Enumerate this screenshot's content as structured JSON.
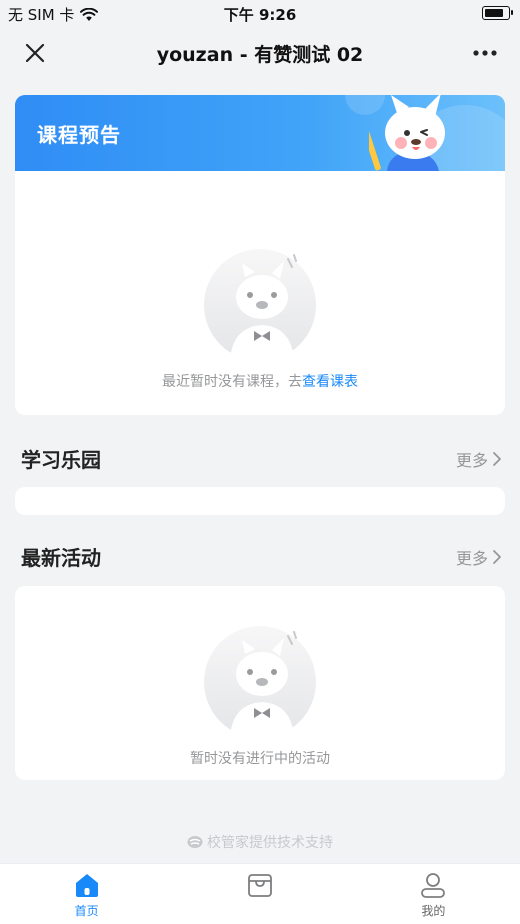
{
  "status_bar": {
    "carrier": "无 SIM 卡",
    "time": "下午 9:26",
    "battery_level": 0.85
  },
  "nav": {
    "title": "youzan - 有赞测试 02"
  },
  "course": {
    "title": "课程预告",
    "empty_text": "最近暂时没有课程，去",
    "empty_link": "查看课表"
  },
  "learning": {
    "title": "学习乐园",
    "more": "更多"
  },
  "activities": {
    "title": "最新活动",
    "more": "更多",
    "empty_text": "暂时没有进行中的活动"
  },
  "footer": {
    "support": "校管家提供技术支持"
  },
  "tabbar": {
    "items": [
      {
        "label": "首页",
        "icon": "home-icon",
        "active": true
      },
      {
        "label": "",
        "icon": "store-icon",
        "active": false
      },
      {
        "label": "我的",
        "icon": "user-icon",
        "active": false
      }
    ]
  },
  "colors": {
    "accent": "#1989fa",
    "header_gradient_start": "#2f8df5",
    "header_gradient_end": "#6cc0fb"
  }
}
